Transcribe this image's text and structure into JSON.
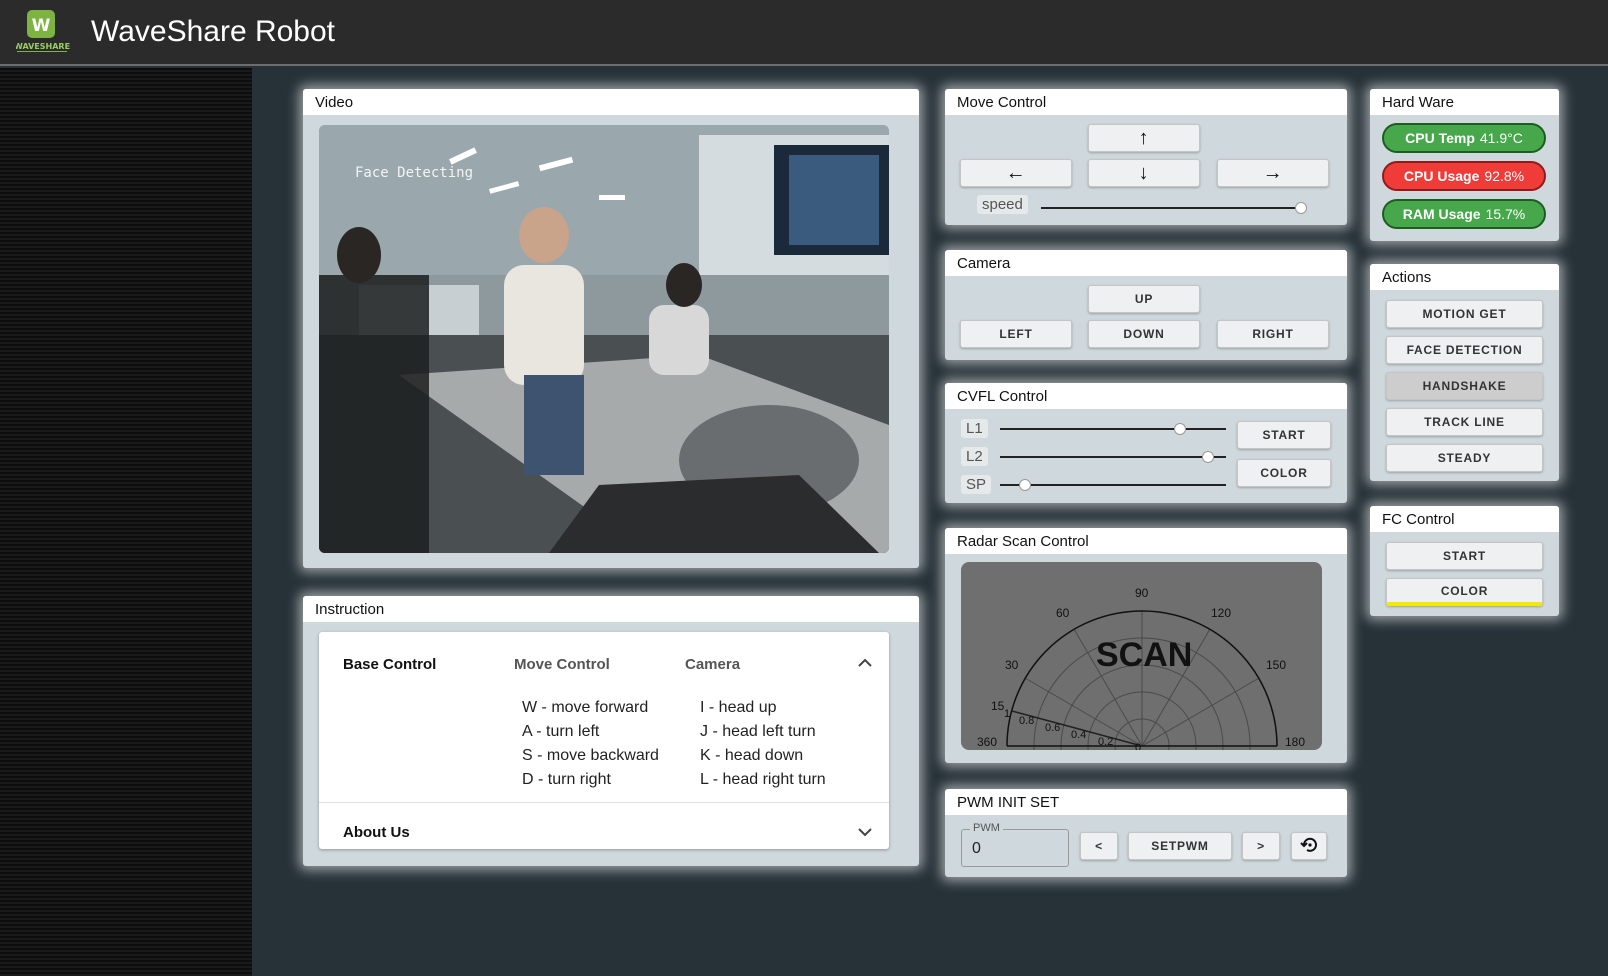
{
  "app": {
    "title": "WaveShare Robot",
    "logo_icon": "waveshare-logo-icon",
    "logo_text": "WAVESHARE"
  },
  "video": {
    "title": "Video",
    "overlay_text": "Face Detecting"
  },
  "move_control": {
    "title": "Move Control",
    "buttons": {
      "up": "arrow-up-icon",
      "left": "arrow-left-icon",
      "down": "arrow-down-icon",
      "right": "arrow-right-icon"
    },
    "speed_label": "speed",
    "speed_value": 1.0
  },
  "camera": {
    "title": "Camera",
    "up": "UP",
    "left": "LEFT",
    "down": "DOWN",
    "right": "RIGHT"
  },
  "cvfl": {
    "title": "CVFL Control",
    "l1_label": "L1",
    "l1_value": 0.79,
    "l2_label": "L2",
    "l2_value": 0.92,
    "sp_label": "SP",
    "sp_value": 0.1,
    "start": "START",
    "color": "COLOR"
  },
  "radar": {
    "title": "Radar Scan Control",
    "scan_label": "SCAN",
    "angle_labels": [
      "90",
      "60",
      "120",
      "30",
      "150",
      "15",
      "360",
      "180"
    ],
    "radius_labels": [
      "1",
      "0.8",
      "0.6",
      "0.4",
      "0.2",
      "0"
    ]
  },
  "pwm": {
    "title": "PWM INIT SET",
    "field_label": "PWM",
    "value": "0",
    "dec": "<",
    "set": "SETPWM",
    "inc": ">",
    "reset_icon": "reset-icon"
  },
  "hardware": {
    "title": "Hard Ware",
    "cpu_temp_label": "CPU Temp",
    "cpu_temp_value": "41.9°C",
    "cpu_usage_label": "CPU Usage",
    "cpu_usage_value": "92.8%",
    "ram_usage_label": "RAM Usage",
    "ram_usage_value": "15.7%",
    "colors": {
      "ok": "#46a84a",
      "warn": "#f03c38"
    }
  },
  "actions": {
    "title": "Actions",
    "items": [
      "MOTION GET",
      "FACE DETECTION",
      "HANDSHAKE",
      "TRACK LINE",
      "STEADY"
    ],
    "active": "HANDSHAKE"
  },
  "fc_control": {
    "title": "FC Control",
    "start": "START",
    "color": "COLOR"
  },
  "instruction": {
    "title": "Instruction",
    "tabs": [
      "Base Control",
      "Move Control",
      "Camera"
    ],
    "move_lines": [
      "W - move forward",
      "A - turn left",
      "S - move backward",
      "D - turn right"
    ],
    "camera_lines": [
      "I - head up",
      "J - head left turn",
      "K - head down",
      "L - head right turn"
    ],
    "about": "About Us"
  }
}
